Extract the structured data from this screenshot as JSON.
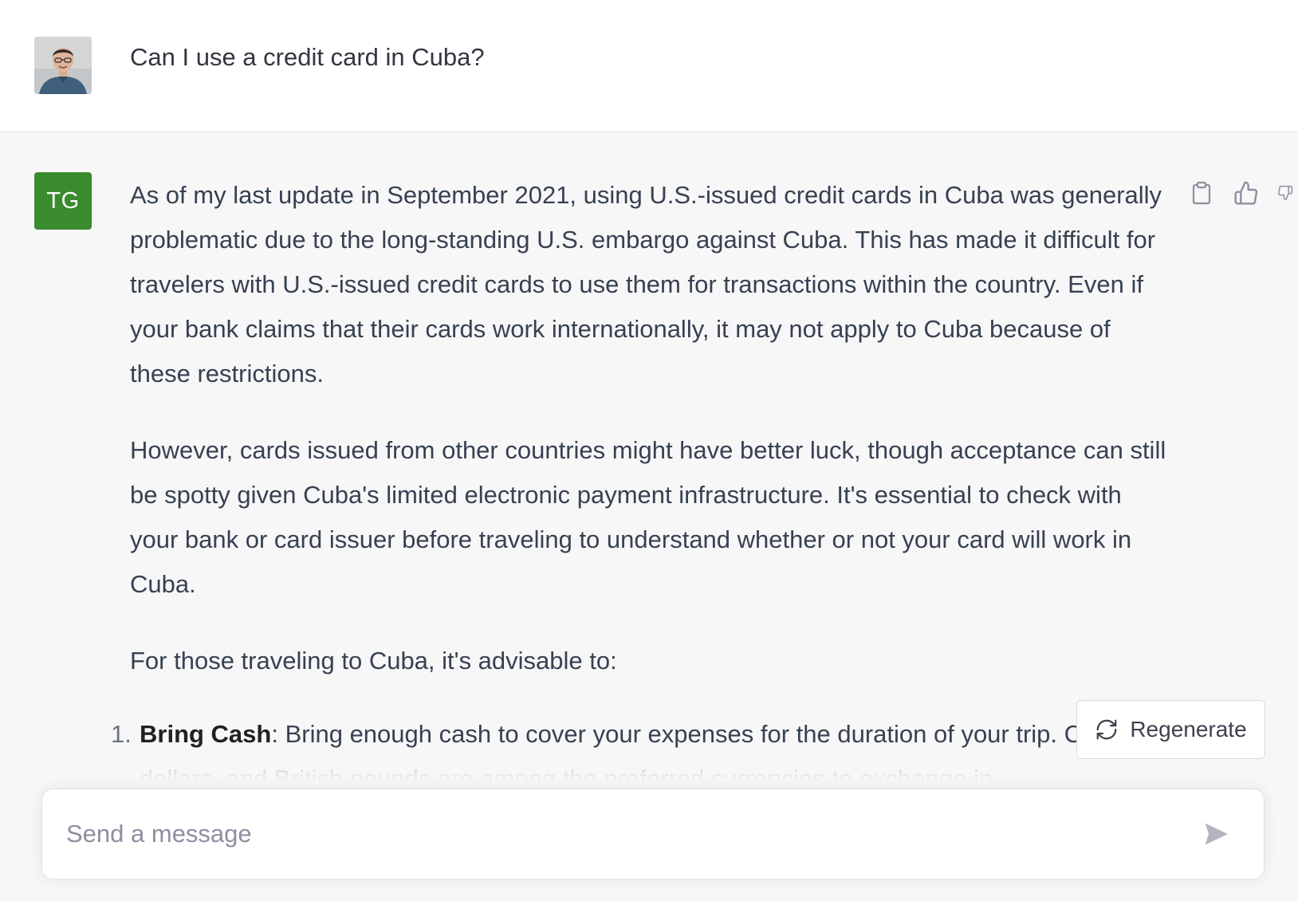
{
  "user_message": {
    "text": "Can I use a credit card in Cuba?"
  },
  "assistant_message": {
    "avatar_initials": "TG",
    "paragraphs": [
      "As of my last update in September 2021, using U.S.-issued credit cards in Cuba was generally problematic due to the long-standing U.S. embargo against Cuba. This has made it difficult for travelers with U.S.-issued credit cards to use them for transactions within the country. Even if your bank claims that their cards work internationally, it may not apply to Cuba because of these restrictions.",
      "However, cards issued from other countries might have better luck, though acceptance can still be spotty given Cuba's limited electronic payment infrastructure. It's essential to check with your bank or card issuer before traveling to understand whether or not your card will work in Cuba.",
      "For those traveling to Cuba, it's advisable to:"
    ],
    "list": [
      {
        "number": "1.",
        "title": "Bring Cash",
        "text": ": Bring enough cash to cover your expenses for the duration of your trip. Canadian dollars, and British pounds are among the preferred currencies to exchange in"
      }
    ],
    "actions": [
      "clipboard-icon",
      "thumbs-up-icon",
      "thumbs-down-icon"
    ]
  },
  "regenerate_button": {
    "label": "Regenerate"
  },
  "composer": {
    "placeholder": "Send a message"
  },
  "colors": {
    "assistant_avatar": "#3a8a2e",
    "page_background": "#f7f7f8",
    "user_row_background": "#ffffff"
  }
}
